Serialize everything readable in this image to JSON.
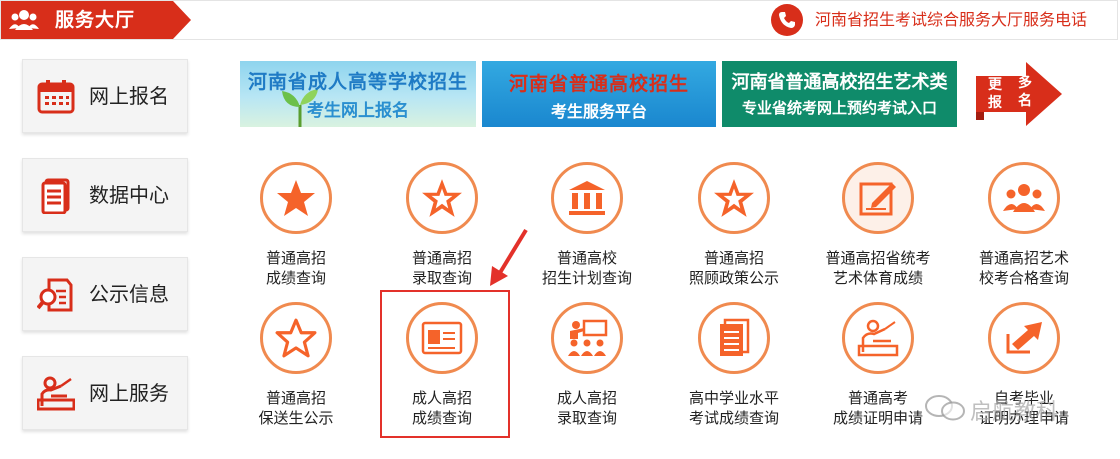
{
  "header": {
    "title": "服务大厅",
    "phone_label": "河南省招生考试综合服务大厅服务电话"
  },
  "sidebar": {
    "items": [
      {
        "label": "网上报名"
      },
      {
        "label": "数据中心"
      },
      {
        "label": "公示信息"
      },
      {
        "label": "网上服务"
      }
    ]
  },
  "banners": [
    {
      "line1": "河南省成人高等学校招生",
      "line2": "考生网上报名"
    },
    {
      "line1": "河南省普通高校招生",
      "line2": "考生服务平台"
    },
    {
      "line1": "河南省普通高校招生艺术类",
      "line2": "专业省统考网上预约考试入口"
    }
  ],
  "more": {
    "c1": "更",
    "c2": "多",
    "c3": "报",
    "c4": "名"
  },
  "services": [
    {
      "line1": "普通高招",
      "line2": "成绩查询"
    },
    {
      "line1": "普通高招",
      "line2": "录取查询"
    },
    {
      "line1": "普通高校",
      "line2": "招生计划查询"
    },
    {
      "line1": "普通高招",
      "line2": "照顾政策公示"
    },
    {
      "line1": "普通高招省统考",
      "line2": "艺术体育成绩"
    },
    {
      "line1": "普通高招艺术",
      "line2": "校考合格查询"
    },
    {
      "line1": "普通高招",
      "line2": "保送生公示"
    },
    {
      "line1": "成人高招",
      "line2": "成绩查询"
    },
    {
      "line1": "成人高招",
      "line2": "录取查询"
    },
    {
      "line1": "高中学业水平",
      "line2": "考试成绩查询"
    },
    {
      "line1": "普通高考",
      "line2": "成绩证明申请"
    },
    {
      "line1": "自考毕业",
      "line2": "证明办理申请"
    }
  ],
  "watermark": {
    "text": "启航教科"
  },
  "colors": {
    "brand_red": "#d82e1a",
    "icon_orange": "#f08a4f",
    "highlight_red": "#e3312a"
  }
}
